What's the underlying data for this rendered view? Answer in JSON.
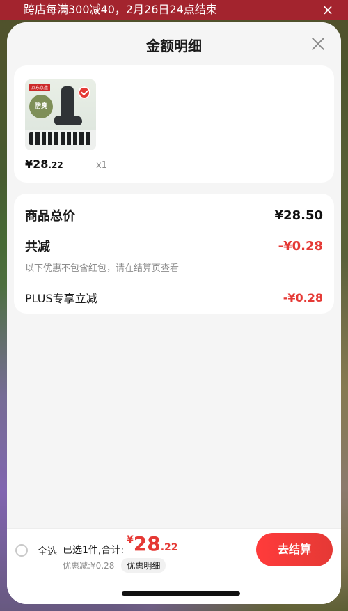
{
  "promo": {
    "text": "跨店每满300减40，2月26日24点结束",
    "close_icon": "×"
  },
  "sheet": {
    "title": "金额明细",
    "close_icon": "close-icon"
  },
  "product": {
    "image_texts": {
      "brand": "京东京造",
      "badge": "防臭"
    },
    "price_main": "¥28",
    "price_cents": ".22",
    "quantity": "x1"
  },
  "summary": {
    "total_label": "商品总价",
    "total_value": "¥28.50",
    "discount_label": "共减",
    "discount_value": "-¥0.28",
    "discount_note": "以下优惠不包含红包，请在结算页查看",
    "plus_label": "PLUS专享立减",
    "plus_value": "-¥0.28"
  },
  "bottom": {
    "select_all": "全选",
    "selected_summary": "已选1件,合计:",
    "currency": "¥",
    "total_int": "28",
    "total_cents": ".22",
    "discount_line": "优惠减:¥0.28",
    "detail_chip": "优惠明细",
    "checkout": "去结算"
  },
  "colors": {
    "accent_red": "#e53935",
    "banner_red": "#a3242e",
    "sheet_bg": "#f5f5f5"
  }
}
